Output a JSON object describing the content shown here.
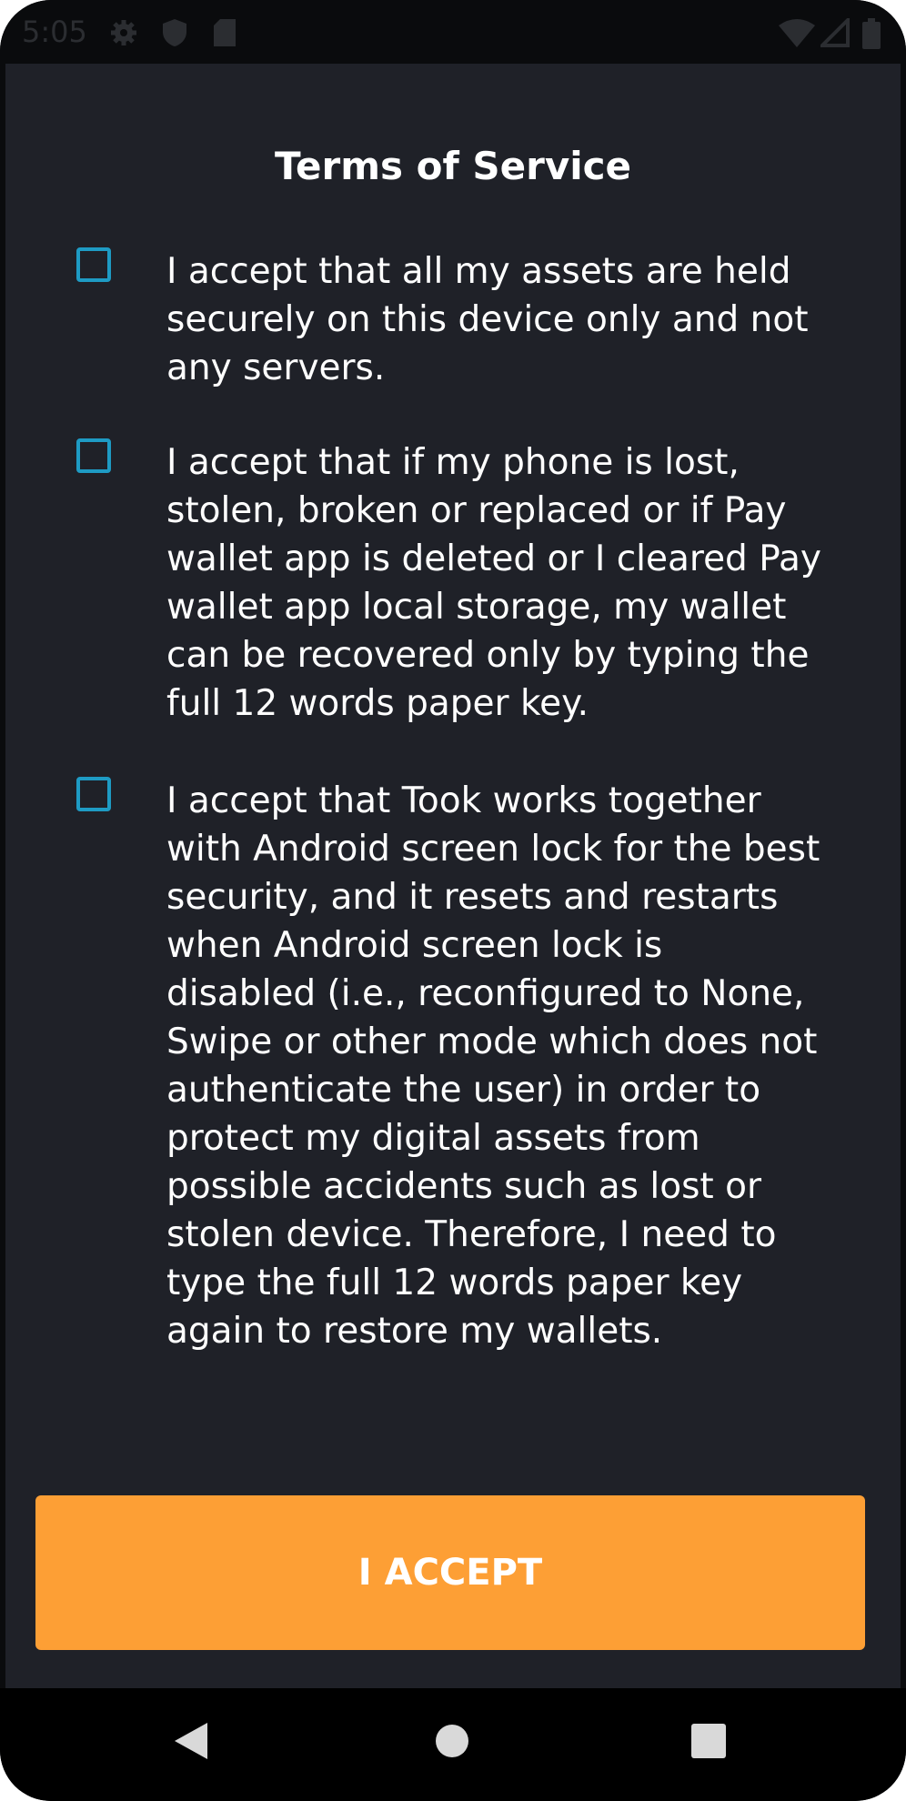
{
  "status_bar": {
    "time": "5:05",
    "icons": [
      "gear-icon",
      "shield-icon",
      "sd-card-icon",
      "wifi-icon",
      "signal-icon",
      "battery-icon"
    ]
  },
  "screen": {
    "title": "Terms of Service",
    "terms": [
      {
        "checked": false,
        "lines": [
          "I accept that all my assets are held",
          "securely on this device only and not",
          "any servers."
        ]
      },
      {
        "checked": false,
        "lines": [
          "I accept that if my phone is lost,",
          "stolen, broken or replaced or if Pay",
          "wallet app is deleted or I cleared Pay",
          "wallet app local storage, my wallet",
          "can be recovered only by typing the",
          "full 12 words paper key."
        ]
      },
      {
        "checked": false,
        "lines": [
          "I accept that Took works together",
          "with Android screen lock for the best",
          "security, and it resets and restarts",
          "when Android screen lock is",
          "disabled (i.e., reconfigured to None,",
          "Swipe or other mode which does not",
          "authenticate the user) in order to",
          "protect my digital assets from",
          "possible accidents such as lost or",
          "stolen device. Therefore, I need to",
          "type the full 12 words paper key",
          "again to restore my wallets."
        ]
      }
    ],
    "accept_button": "I ACCEPT"
  },
  "nav_bar": {
    "buttons": [
      "back-icon",
      "home-icon",
      "recents-icon"
    ]
  },
  "colors": {
    "background": "#1f2128",
    "checkbox_border": "#1e9bc4",
    "accent": "#fd9f35",
    "text": "#ffffff"
  }
}
